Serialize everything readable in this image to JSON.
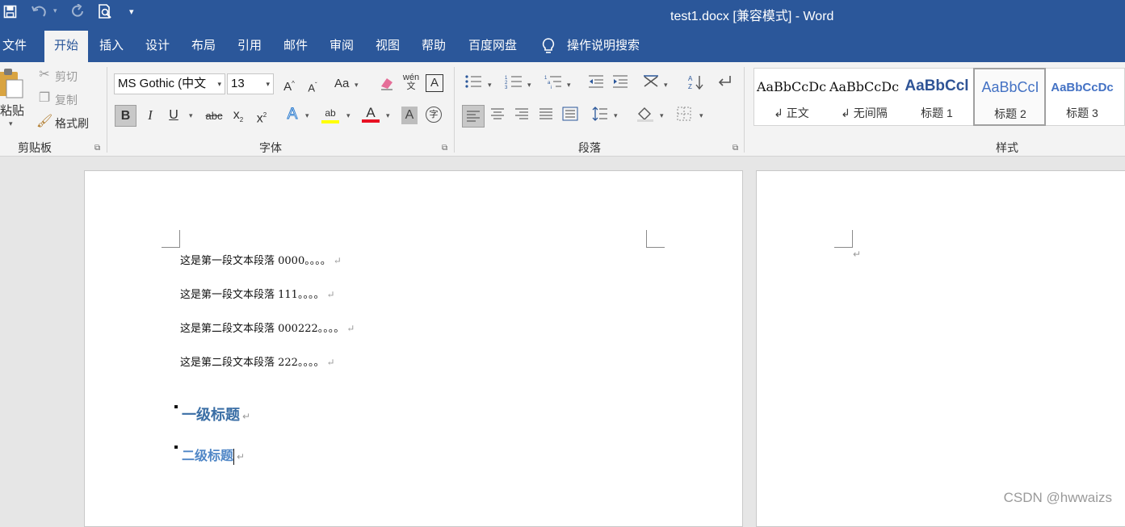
{
  "window": {
    "title": "test1.docx [兼容模式]  -  Word"
  },
  "quick_access": {
    "save_icon": "save-icon",
    "undo_icon": "undo-icon",
    "redo_icon": "redo-icon",
    "preview_icon": "print-preview-icon",
    "customize_icon": "customize-qat-icon"
  },
  "tabs": [
    {
      "label": "文件"
    },
    {
      "label": "开始"
    },
    {
      "label": "插入"
    },
    {
      "label": "设计"
    },
    {
      "label": "布局"
    },
    {
      "label": "引用"
    },
    {
      "label": "邮件"
    },
    {
      "label": "审阅"
    },
    {
      "label": "视图"
    },
    {
      "label": "帮助"
    },
    {
      "label": "百度网盘"
    }
  ],
  "tell_me": {
    "label": "操作说明搜索",
    "icon": "lightbulb-icon"
  },
  "clipboard": {
    "paste": "粘贴",
    "cut": "剪切",
    "copy": "复制",
    "format_painter": "格式刷",
    "group_label": "剪贴板"
  },
  "font": {
    "name": "MS Gothic (中文",
    "size": "13",
    "group_label": "字体",
    "change_case": "Aa",
    "bold": "B",
    "italic": "I",
    "underline": "U",
    "strike": "abc",
    "sub": "x",
    "sup": "x",
    "color_accent": "#e81123",
    "highlight_accent": "#ffff00"
  },
  "paragraph": {
    "group_label": "段落"
  },
  "styles": {
    "group_label": "样式",
    "items": [
      {
        "sample": "AaBbCcDc",
        "name": "↲ 正文"
      },
      {
        "sample": "AaBbCcDc",
        "name": "↲ 无间隔"
      },
      {
        "sample": "AaBbCcl",
        "name": "标题 1"
      },
      {
        "sample": "AaBbCcI",
        "name": "标题 2"
      },
      {
        "sample": "AaBbCcDc",
        "name": "标题 3"
      }
    ],
    "selected_index": 3
  },
  "document": {
    "paragraphs": [
      "这是第一段文本段落 0000。。。。",
      "这是第一段文本段落 111。。。。",
      "这是第二段文本段落 000222。。。。",
      "这是第二段文本段落 222。。。。"
    ],
    "heading1": "一级标题",
    "heading2": "二级标题",
    "para_mark": "↵",
    "heading_color": "#3a6ea5"
  },
  "watermark": "CSDN @hwwaizs"
}
